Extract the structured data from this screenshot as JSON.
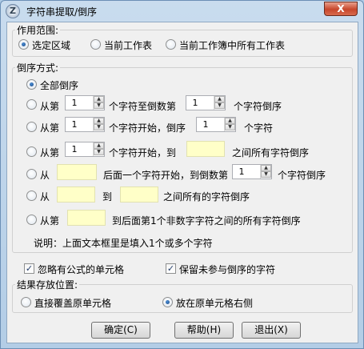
{
  "window": {
    "title": "字符串提取/倒序",
    "close_label": "X"
  },
  "scope": {
    "label": "作用范围:",
    "options": [
      "选定区域",
      "当前工作表",
      "当前工作簿中所有工作表"
    ],
    "selected": 0
  },
  "reverse": {
    "label": "倒序方式:",
    "opt_all": "全部倒序",
    "opt1": {
      "a": "从第",
      "v1": "1",
      "b": "个字符至倒数第",
      "v2": "1",
      "c": "个字符倒序"
    },
    "opt2": {
      "a": "从第",
      "v1": "1",
      "b": "个字符开始，倒序",
      "v2": "1",
      "c": "个字符"
    },
    "opt3": {
      "a": "从第",
      "v1": "1",
      "b": "个字符开始，到",
      "c": "之间所有字符倒序"
    },
    "opt4": {
      "a": "从",
      "b": "后面一个字符开始，到倒数第",
      "v1": "1",
      "c": "个字符倒序"
    },
    "opt5": {
      "a": "从",
      "b": "到",
      "c": "之间所有的字符倒序"
    },
    "opt6": {
      "a": "从第",
      "b": "到后面第1个非数字字符之间的所有字符倒序"
    },
    "note": "说明：上面文本框里是填入1个或多个字符"
  },
  "checks": {
    "ignore_formula": "忽略有公式的单元格",
    "keep_unused": "保留未参与倒序的字符"
  },
  "result": {
    "label": "结果存放位置:",
    "overwrite": "直接覆盖原单元格",
    "right": "放在原单元格右侧"
  },
  "buttons": {
    "ok": "确定(C)",
    "help": "帮助(H)",
    "exit": "退出(X)"
  }
}
